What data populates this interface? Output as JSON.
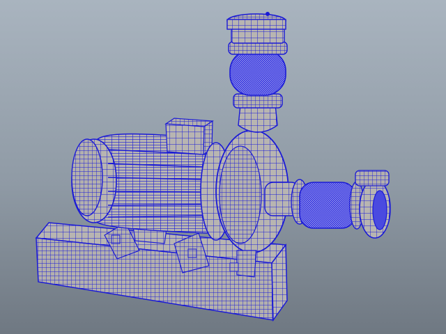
{
  "viewport": {
    "background_top": "#a9b4bf",
    "background_bottom": "#6f7882"
  },
  "model": {
    "surface_color": "#b8b5b1",
    "wire_color": "#1a1ad6",
    "dense_wire_color": "#2a2ae0"
  }
}
